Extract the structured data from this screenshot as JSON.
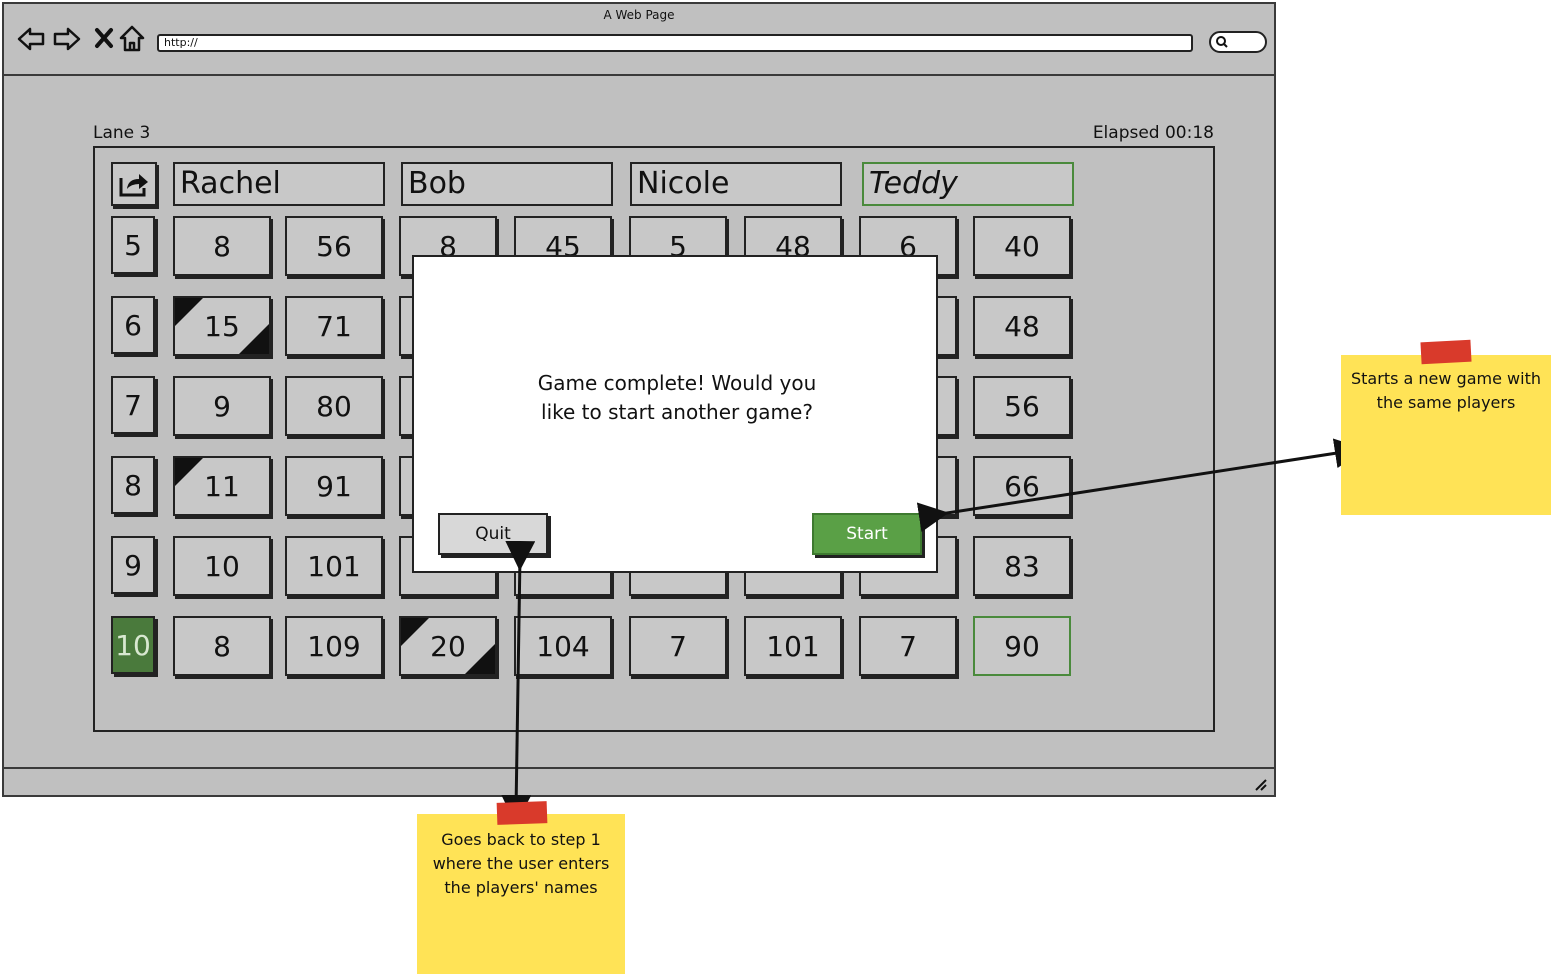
{
  "window": {
    "title": "A Web Page",
    "url": "http://"
  },
  "header": {
    "lane": "Lane 3",
    "elapsed": "Elapsed 00:18"
  },
  "players": [
    {
      "name": "Rachel"
    },
    {
      "name": "Bob"
    },
    {
      "name": "Nicole"
    },
    {
      "name": "Teddy",
      "active": true
    }
  ],
  "rows": [
    {
      "frame": "5",
      "scores": [
        "8",
        "56",
        "8",
        "45",
        "5",
        "48",
        "6",
        "40"
      ]
    },
    {
      "frame": "6",
      "scores": [
        "15",
        "71",
        "",
        "",
        "",
        "",
        "",
        "48"
      ]
    },
    {
      "frame": "7",
      "scores": [
        "9",
        "80",
        "",
        "",
        "",
        "",
        "",
        "56"
      ]
    },
    {
      "frame": "8",
      "scores": [
        "11",
        "91",
        "",
        "",
        "",
        "",
        "",
        "66"
      ]
    },
    {
      "frame": "9",
      "scores": [
        "10",
        "101",
        "",
        "",
        "",
        "",
        "",
        "83"
      ]
    },
    {
      "frame": "10",
      "scores": [
        "8",
        "109",
        "20",
        "104",
        "7",
        "101",
        "7",
        "90"
      ],
      "current": true
    }
  ],
  "dialog": {
    "message": "Game complete! Would you like to start another game?",
    "quit_label": "Quit",
    "start_label": "Start"
  },
  "notes": {
    "start_note": "Starts a new game with the same players",
    "quit_note": "Goes back to step 1 where the user enters the players' names"
  },
  "icons": [
    "back-arrow-icon",
    "forward-arrow-icon",
    "close-icon",
    "home-icon",
    "search-icon",
    "share-icon",
    "resize-grip-icon"
  ],
  "colors": {
    "accent_green": "#5aa046",
    "current_frame": "#4a7a3c",
    "sticky_note": "#ffe356",
    "tape": "#d93a2b"
  }
}
